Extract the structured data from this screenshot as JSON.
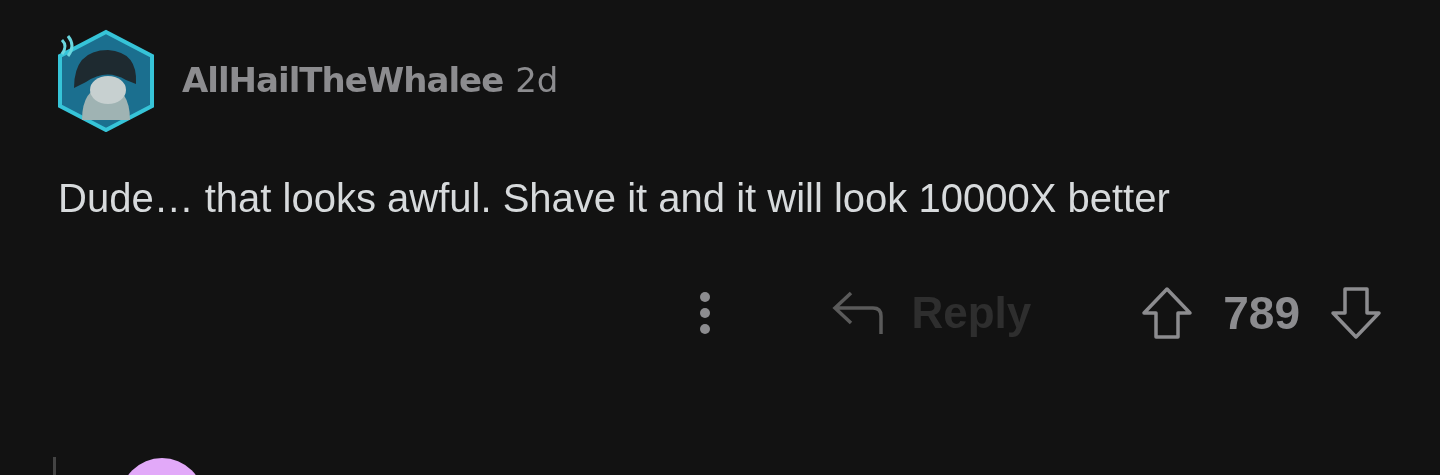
{
  "comment": {
    "author": "AllHailTheWhalee",
    "age": "2d",
    "body": "Dude… that looks awful. Shave it and it will look 10000X better",
    "actions": {
      "reply": {
        "label": "Reply",
        "disabled": true
      },
      "score": "789"
    }
  }
}
